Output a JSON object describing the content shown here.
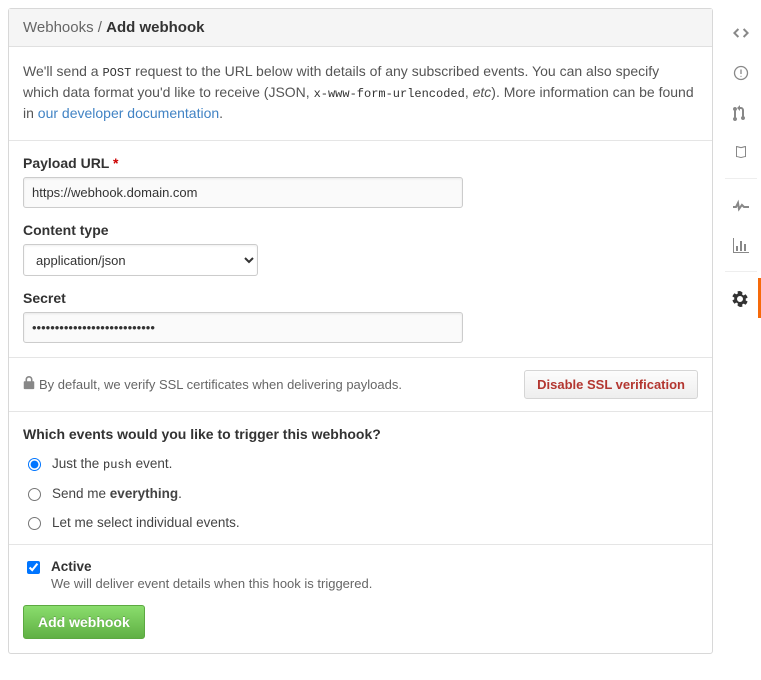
{
  "breadcrumb": {
    "parent": "Webhooks",
    "sep": " / ",
    "current": "Add webhook"
  },
  "intro": {
    "p1a": "We'll send a ",
    "p1code": "POST",
    "p1b": " request to the URL below with details of any subscribed events. You can also specify which data format you'd like to receive (JSON, ",
    "p1code2": "x-www-form-urlencoded",
    "p1c": ", ",
    "p1i": "etc",
    "p1d": "). More information can be found in ",
    "link": "our developer documentation",
    "p1e": "."
  },
  "form": {
    "payload_label": "Payload URL",
    "payload_value": "https://webhook.domain.com",
    "content_type_label": "Content type",
    "content_type_value": "application/json",
    "secret_label": "Secret",
    "secret_value": "•••••••••••••••••••••••••••"
  },
  "ssl": {
    "note": "By default, we verify SSL certificates when delivering payloads.",
    "button": "Disable SSL verification"
  },
  "events": {
    "title": "Which events would you like to trigger this webhook?",
    "opt1a": "Just the ",
    "opt1code": "push",
    "opt1b": " event.",
    "opt2a": "Send me ",
    "opt2b": "everything",
    "opt2c": ".",
    "opt3": "Let me select individual events."
  },
  "active": {
    "label": "Active",
    "desc": "We will deliver event details when this hook is triggered."
  },
  "submit": {
    "label": "Add webhook"
  }
}
